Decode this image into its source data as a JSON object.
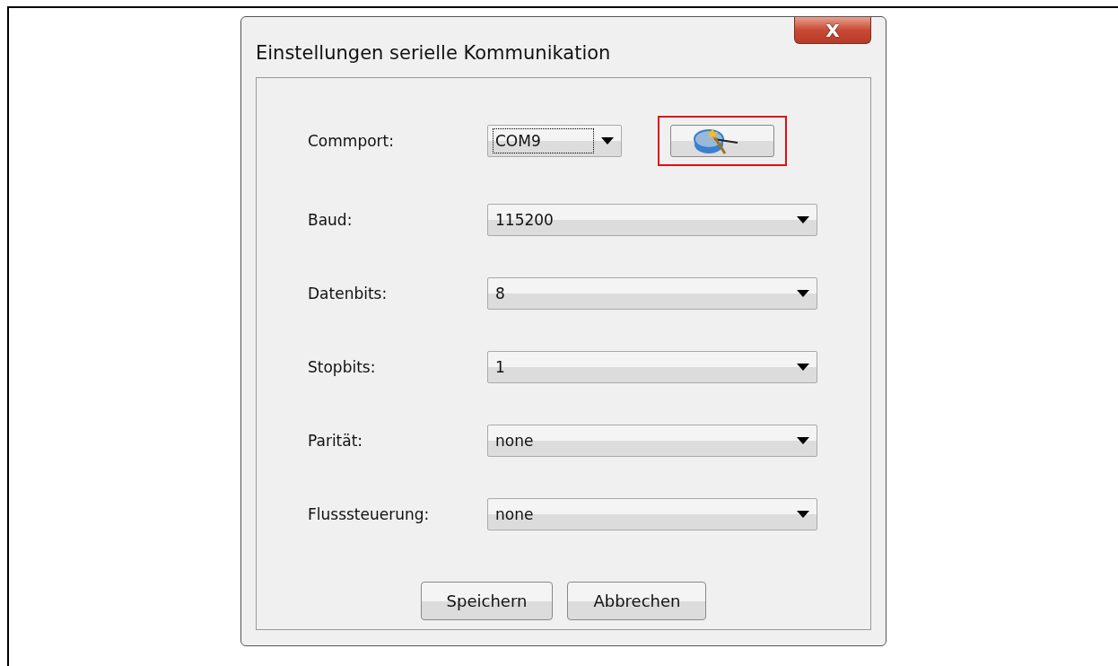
{
  "window": {
    "title": "Einstellungen serielle Kommunikation",
    "close_label": "X"
  },
  "commport": {
    "label": "Commport:",
    "value": "COM9",
    "focused": true,
    "highlighted": true
  },
  "fields": [
    {
      "label": "Baud:",
      "value": "115200"
    },
    {
      "label": "Datenbits:",
      "value": "8"
    },
    {
      "label": "Stopbits:",
      "value": "1"
    },
    {
      "label": "Parität:",
      "value": "none"
    },
    {
      "label": "Flusssteuerung:",
      "value": "none"
    }
  ],
  "buttons": [
    "Speichern",
    "Abbrechen"
  ]
}
